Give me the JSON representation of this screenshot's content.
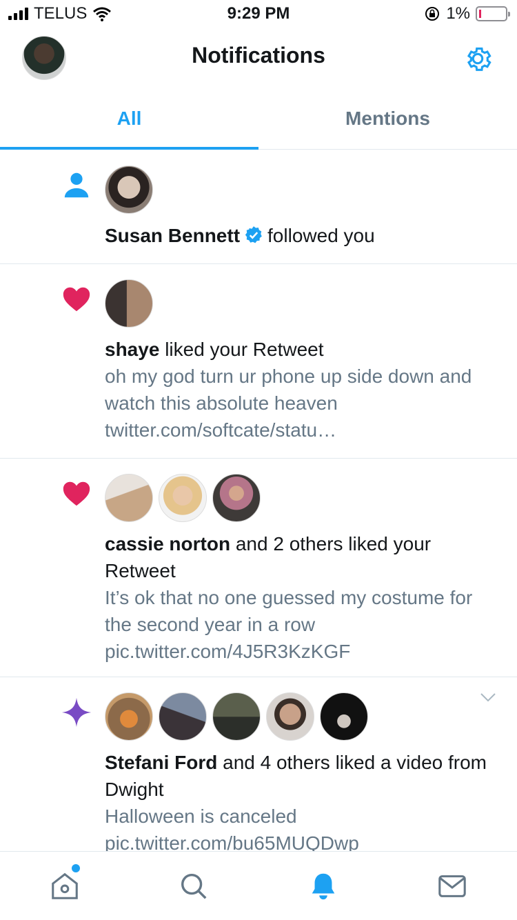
{
  "status_bar": {
    "carrier": "TELUS",
    "time": "9:29 PM",
    "battery": "1%"
  },
  "header": {
    "title": "Notifications"
  },
  "tabs": [
    {
      "label": "All",
      "active": true
    },
    {
      "label": "Mentions",
      "active": false
    }
  ],
  "notifications": [
    {
      "kind_icon": "follow-person-icon",
      "actor": "Susan Bennett",
      "verified": true,
      "action": "followed you",
      "avatar_count": 1
    },
    {
      "kind_icon": "heart-icon",
      "actor": "shaye",
      "action": "liked your Retweet",
      "snippet": "oh my god turn ur phone up side down and watch this absolute heaven twitter.com/softcate/statu…",
      "avatar_count": 1
    },
    {
      "kind_icon": "heart-icon",
      "actor": "cassie norton",
      "action": "and 2 others liked your Retweet",
      "snippet": "It’s ok that no one guessed my costume for the second year in a row pic.twitter.com/4J5R3KzKGF",
      "avatar_count": 3
    },
    {
      "kind_icon": "sparkle-icon",
      "actor": "Stefani Ford",
      "action": "and 4 others liked a video from Dwight",
      "snippet": "Halloween is canceled pic.twitter.com/bu65MUQDwp",
      "avatar_count": 5
    }
  ],
  "colors": {
    "accent": "#1da1f2",
    "like": "#e0245e",
    "sparkle": "#794bc4",
    "secondary_text": "#657786"
  },
  "bottom_nav": [
    {
      "icon": "home-icon",
      "badge": true
    },
    {
      "icon": "search-icon",
      "badge": false
    },
    {
      "icon": "bell-icon",
      "badge": false,
      "active": true
    },
    {
      "icon": "mail-icon",
      "badge": false
    }
  ]
}
